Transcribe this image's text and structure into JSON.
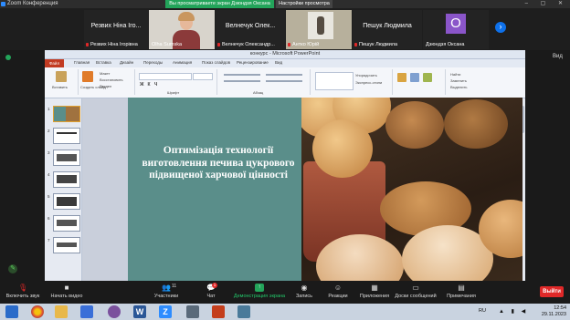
{
  "zoom": {
    "window_title": "Zoom Конференция",
    "share_banner": "Вы просматриваете экран Дзюндзя Оксана",
    "view_options": "Настройки просмотра",
    "view_label": "Вид"
  },
  "participants": [
    {
      "big_name": "Резвих  Ніна Іго...",
      "name": "Резвих Ніна Ігорівна",
      "muted": true,
      "kind": "name"
    },
    {
      "big_name": "",
      "name": "Olha Sumska",
      "muted": false,
      "kind": "video"
    },
    {
      "big_name": "Велнечук  Олек...",
      "name": "Велнечук Олександр...",
      "muted": true,
      "kind": "name"
    },
    {
      "big_name": "",
      "name": "Антко Юрій",
      "muted": true,
      "kind": "photo"
    },
    {
      "big_name": "Пешук Людмила",
      "name": "Пешук Людмила",
      "muted": true,
      "kind": "name"
    },
    {
      "big_name": "О",
      "name": "Дзюндзя Оксана",
      "muted": false,
      "kind": "avatar"
    }
  ],
  "powerpoint": {
    "window_title": "конкурс - Microsoft PowerPoint",
    "tabs": [
      "Файл",
      "Главная",
      "Вставка",
      "Дизайн",
      "Переходы",
      "Анимация",
      "Показ слайдов",
      "Рецензирование",
      "Вид"
    ],
    "ribbon_labels": [
      "Вставить",
      "Создать слайд",
      "Макет",
      "Восстановить",
      "Раздел",
      "Шрифт",
      "Абзац",
      "Упорядочить",
      "Экспресс-стили",
      "Найти",
      "Заменить",
      "Выделить"
    ],
    "thumb_numbers": [
      "1",
      "2",
      "3",
      "4",
      "5",
      "6",
      "7"
    ]
  },
  "slide": {
    "title": "Оптимізація технології виготовлення печива цукрового підвищеної харчової цінності",
    "accent_color": "#5a8e8a"
  },
  "toolbar": {
    "mute": "Включить звук",
    "video": "Начать видео",
    "participants": "Участники",
    "participants_count": "11",
    "chat": "Чат",
    "chat_badge": "1",
    "share": "Демонстрация экрана",
    "record": "Запись",
    "reactions": "Реакции",
    "apps": "Приложения",
    "whiteboard": "Доски сообщений",
    "notes": "Примечания",
    "end": "Выйти"
  },
  "taskbar": {
    "lang": "RU",
    "time": "12:54",
    "date": "29.11.2023"
  }
}
